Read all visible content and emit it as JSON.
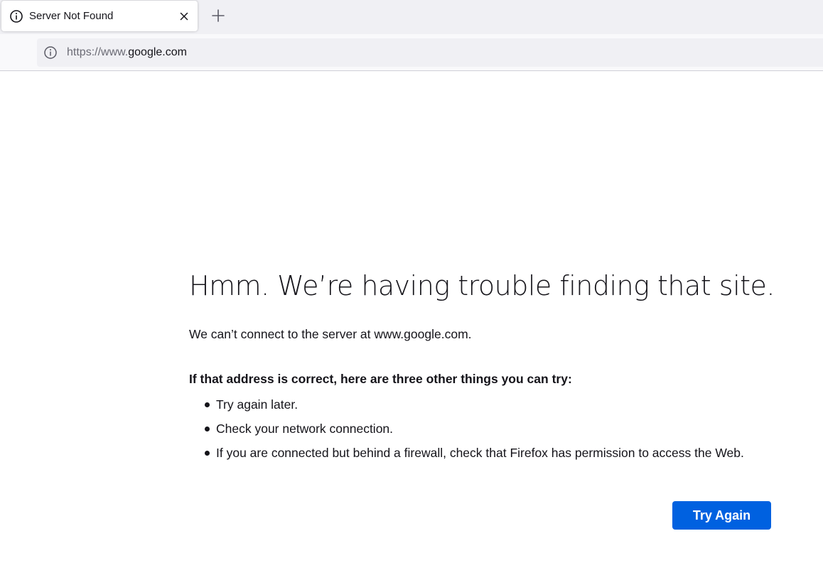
{
  "browser": {
    "tab": {
      "title": "Server Not Found",
      "icon": "info-icon",
      "close_icon": "close-icon"
    },
    "new_tab_icon": "plus-icon",
    "urlbar": {
      "icon": "info-icon",
      "scheme_prefix": "https://www.",
      "host": "google.com"
    }
  },
  "error_page": {
    "title": "Hmm. We’re having trouble finding that site.",
    "description": "We can’t connect to the server at www.google.com.",
    "tips_heading": "If that address is correct, here are three other things you can try:",
    "tips": [
      "Try again later.",
      "Check your network connection.",
      "If you are connected but behind a firewall, check that Firefox has permission to access the Web."
    ],
    "try_again_label": "Try Again"
  },
  "colors": {
    "accent": "#0061e0",
    "text": "#15141a",
    "tabbar_bg": "#f0f0f4",
    "muted_text": "#6b6b75"
  }
}
